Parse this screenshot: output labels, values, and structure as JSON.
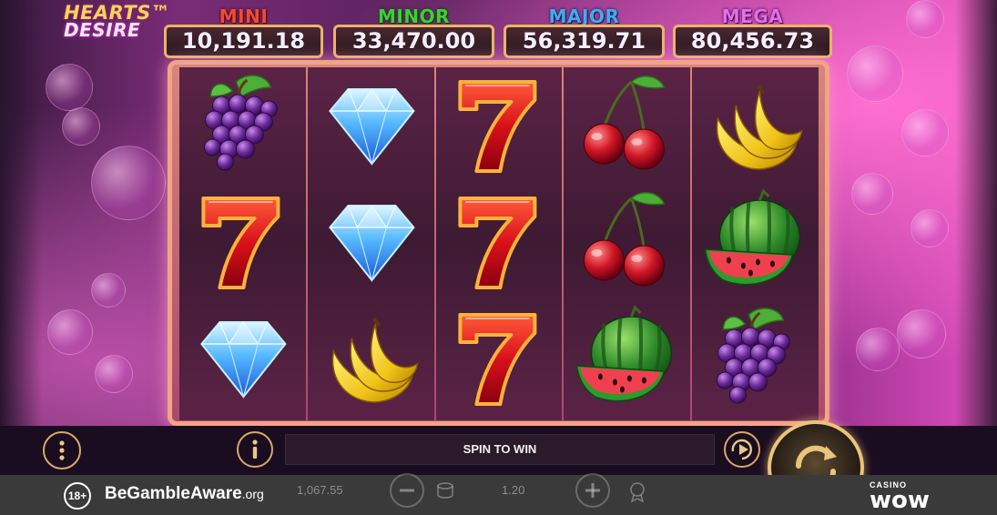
{
  "game": {
    "logo_line1": "HEARTS™",
    "logo_line2": "DESIRE"
  },
  "jackpots": [
    {
      "label": "MINI",
      "value": "10,191.18",
      "color": "#f04a3a"
    },
    {
      "label": "MINOR",
      "value": "33,470.00",
      "color": "#3fce3a"
    },
    {
      "label": "MAJOR",
      "value": "56,319.71",
      "color": "#4aa6f0"
    },
    {
      "label": "MEGA",
      "value": "80,456.73",
      "color": "#e070e8"
    }
  ],
  "reels": [
    [
      "grapes-icon",
      "seven-icon",
      "diamond-icon"
    ],
    [
      "diamond-icon",
      "diamond-icon",
      "banana-icon"
    ],
    [
      "seven-icon",
      "seven-icon",
      "seven-icon"
    ],
    [
      "cherry-icon",
      "cherry-icon",
      "watermelon-icon"
    ],
    [
      "banana-icon",
      "watermelon-icon",
      "grapes-icon"
    ]
  ],
  "controls": {
    "spin_banner": "SPIN TO WIN",
    "menu_icon": "menu-dots-icon",
    "info_icon": "info-icon",
    "play_icon": "autoplay-icon",
    "spin_icon": "spin-icon"
  },
  "faded_bar": {
    "balance": "1,067.55",
    "bet": "1.20"
  },
  "footer": {
    "age": "18+",
    "gamble_aware": "BeGambleAware",
    "gamble_aware_suffix": ".org",
    "casino_small": "CASINO",
    "casino_big": "wow"
  }
}
